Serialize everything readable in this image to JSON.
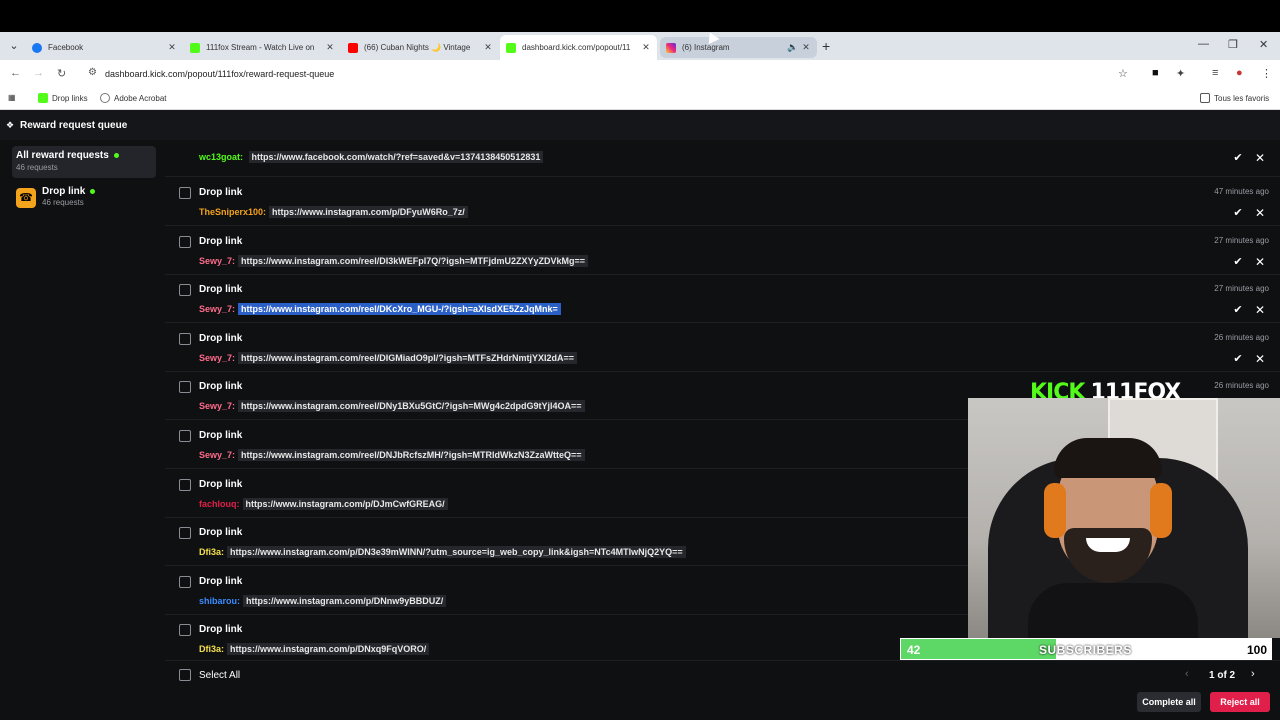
{
  "browser": {
    "tabs": [
      {
        "title": "Facebook",
        "icon": "facebook-icon",
        "color": "#1877f2"
      },
      {
        "title": "111fox Stream - Watch Live on",
        "icon": "kick-icon",
        "color": "#53fc18"
      },
      {
        "title": "(66) Cuban Nights 🌙 Vintage",
        "icon": "youtube-icon",
        "color": "#ff0000"
      },
      {
        "title": "dashboard.kick.com/popout/11",
        "icon": "kick-icon",
        "color": "#53fc18"
      },
      {
        "title": "(6) Instagram",
        "icon": "instagram-icon",
        "color": "#d6249f"
      }
    ],
    "url": "dashboard.kick.com/popout/111fox/reward-request-queue",
    "bookmarks": [
      {
        "label": "Drop links",
        "icon": "kick-icon"
      },
      {
        "label": "Adobe Acrobat",
        "icon": "acrobat-icon"
      }
    ],
    "all_bookmarks_label": "Tous les favoris"
  },
  "app": {
    "title": "Reward request queue",
    "sidebar": [
      {
        "label": "All reward requests",
        "sub": "46 requests"
      },
      {
        "label": "Drop link",
        "sub": "46 requests"
      }
    ],
    "first_line": {
      "user": "wc13goat",
      "link": "https://www.facebook.com/watch/?ref=saved&v=1374138450512831",
      "user_color": "#53fc18"
    },
    "rows": [
      {
        "title": "Drop link",
        "time": "47 minutes ago",
        "user": "TheSniperx100",
        "user_color": "#f4a31c",
        "link": "https://www.instagram.com/p/DFyuW6Ro_7z/",
        "highlight": false
      },
      {
        "title": "Drop link",
        "time": "27 minutes ago",
        "user": "Sewy_7",
        "user_color": "#ff6b8a",
        "link": "https://www.instagram.com/reel/DI3kWEFpI7Q/?igsh=MTFjdmU2ZXYyZDVkMg==",
        "highlight": false
      },
      {
        "title": "Drop link",
        "time": "27 minutes ago",
        "user": "Sewy_7",
        "user_color": "#ff6b8a",
        "link": "https://www.instagram.com/reel/DKcXro_MGU-/?igsh=aXlsdXE5ZzJqMnk=",
        "highlight": true
      },
      {
        "title": "Drop link",
        "time": "26 minutes ago",
        "user": "Sewy_7",
        "user_color": "#ff6b8a",
        "link": "https://www.instagram.com/reel/DIGMiadO9pI/?igsh=MTFsZHdrNmtjYXI2dA==",
        "highlight": false
      },
      {
        "title": "Drop link",
        "time": "26 minutes ago",
        "user": "Sewy_7",
        "user_color": "#ff6b8a",
        "link": "https://www.instagram.com/reel/DNy1BXu5GtC/?igsh=MWg4c2dpdG9tYjl4OA==",
        "highlight": false
      },
      {
        "title": "Drop link",
        "time": "",
        "user": "Sewy_7",
        "user_color": "#ff6b8a",
        "link": "https://www.instagram.com/reel/DNJbRcfszMH/?igsh=MTRldWkzN3ZzaWtteQ==",
        "highlight": false
      },
      {
        "title": "Drop link",
        "time": "",
        "user": "fachlouq",
        "user_color": "#e0204a",
        "link": "https://www.instagram.com/p/DJmCwfGREAG/",
        "highlight": false
      },
      {
        "title": "Drop link",
        "time": "",
        "user": "Dfi3a",
        "user_color": "#f4e04d",
        "link": "https://www.instagram.com/p/DN3e39mWINN/?utm_source=ig_web_copy_link&igsh=NTc4MTIwNjQ2YQ==",
        "highlight": false
      },
      {
        "title": "Drop link",
        "time": "",
        "user": "shibarou",
        "user_color": "#3a8bff",
        "link": "https://www.instagram.com/p/DNnw9yBBDUZ/",
        "highlight": false
      },
      {
        "title": "Drop link",
        "time": "",
        "user": "Dfi3a",
        "user_color": "#f4e04d",
        "link": "https://www.instagram.com/p/DNxq9FqVORO/",
        "highlight": false
      }
    ],
    "select_all": "Select All",
    "pager": "1 of 2",
    "complete_all": "Complete all",
    "reject_all": "Reject all"
  },
  "overlay": {
    "logo_kick": "KICK",
    "logo_name": "111FOX",
    "sub_current": "42",
    "sub_label": "SUBSCRIBERS",
    "sub_goal": "100",
    "sub_progress": 0.42
  }
}
